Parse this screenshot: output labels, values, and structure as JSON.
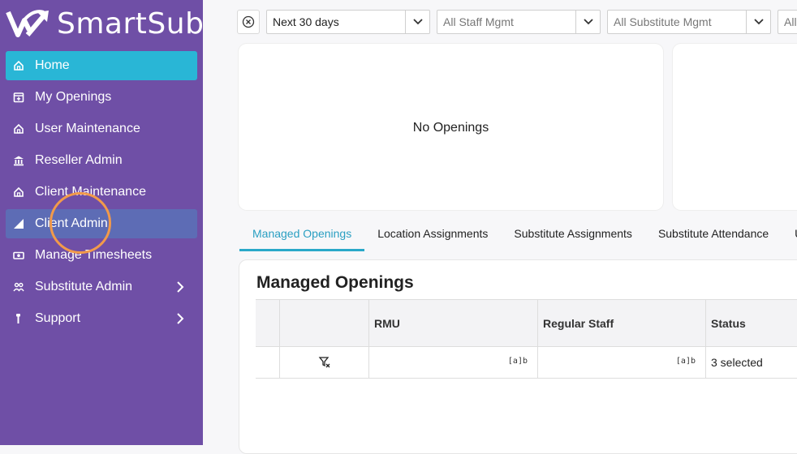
{
  "app": {
    "brand": "SmartSub"
  },
  "sidebar": {
    "items": [
      {
        "label": "Home",
        "icon": "home-icon",
        "state": "active"
      },
      {
        "label": "My Openings",
        "icon": "calendar-plus-icon"
      },
      {
        "label": "User Maintenance",
        "icon": "home-icon"
      },
      {
        "label": "Reseller Admin",
        "icon": "bank-icon"
      },
      {
        "label": "Client Maintenance",
        "icon": "home-icon"
      },
      {
        "label": "Client Admin",
        "icon": "bar-chart-icon",
        "state": "hover"
      },
      {
        "label": "Manage Timesheets",
        "icon": "money-icon"
      },
      {
        "label": "Substitute Admin",
        "icon": "users-icon",
        "has_submenu": true
      },
      {
        "label": "Support",
        "icon": "wrench-icon",
        "has_submenu": true
      }
    ],
    "colors": {
      "background": "#6f4fa6",
      "active": "#29b6d6",
      "hover": "#5d6cb5",
      "highlight_ring": "#f29a4a"
    }
  },
  "filters": {
    "date_range": "Next 30 days",
    "staff_mgmt": "All Staff Mgmt",
    "substitute_mgmt": "All Substitute Mgmt",
    "fourth": "All"
  },
  "cards": {
    "first_empty": "No Openings"
  },
  "tabs": [
    {
      "label": "Managed Openings",
      "active": true
    },
    {
      "label": "Location Assignments"
    },
    {
      "label": "Substitute Assignments"
    },
    {
      "label": "Substitute Attendance"
    },
    {
      "label": "U"
    }
  ],
  "panel": {
    "title": "Managed Openings",
    "columns": [
      "",
      "",
      "RMU",
      "Regular Staff",
      "Status"
    ],
    "filter_row": {
      "status_value": "3 selected",
      "text_filter_icon": "[a]b"
    }
  }
}
